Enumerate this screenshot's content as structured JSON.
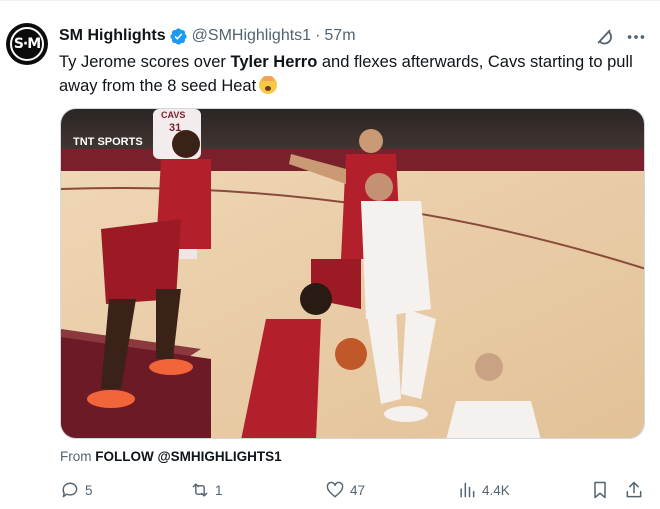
{
  "tweet": {
    "author_name": "SM Highlights",
    "avatar_text": "S·M",
    "handle": "@SMHighlights1",
    "separator": "·",
    "time": "57m",
    "text_part1": "Ty Jerome scores over ",
    "text_bold": "Tyler Herro",
    "text_part2": " and flexes afterwards, Cavs starting to pull away from the 8 seed Heat",
    "emoji": "shocked-face-emoji"
  },
  "media": {
    "broadcaster_logo": "TNT SPORTS",
    "jersey_back_text": "CAVS",
    "jersey_back_number": "31"
  },
  "source": {
    "prefix": "From",
    "name": "FOLLOW @SMHIGHLIGHTS1"
  },
  "actions": {
    "replies": "5",
    "reposts": "1",
    "likes": "47",
    "views": "4.4K"
  },
  "colors": {
    "text": "#0f1419",
    "muted": "#536471",
    "verified": "#1d9bf0",
    "heat_red": "#b3202c",
    "court": "#e8c9a3"
  }
}
